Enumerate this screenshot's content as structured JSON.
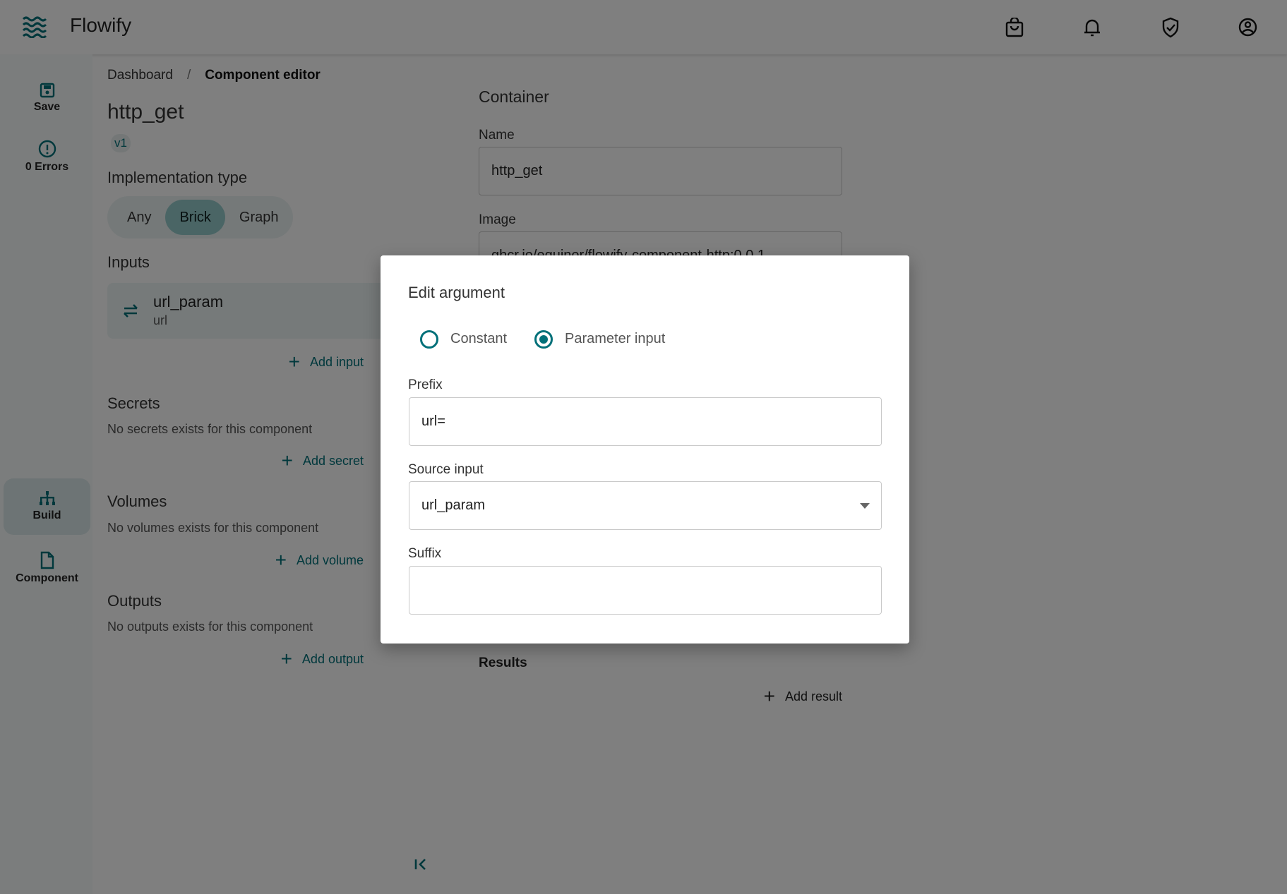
{
  "app": {
    "title": "Flowify",
    "accent": "#007079"
  },
  "header_icons": [
    "shopping-bag-icon",
    "bell-icon",
    "shield-check-icon",
    "account-circle-icon"
  ],
  "sidebar": {
    "items": [
      {
        "label": "Save",
        "icon": "save-icon"
      },
      {
        "label": "0 Errors",
        "icon": "error-icon"
      },
      {
        "label": "Build",
        "icon": "hierarchy-icon",
        "active": true
      },
      {
        "label": "Component",
        "icon": "file-icon"
      }
    ]
  },
  "breadcrumb": {
    "items": [
      "Dashboard",
      "Component editor"
    ],
    "separator": "/"
  },
  "component": {
    "title": "http_get",
    "version": "v1"
  },
  "implementation": {
    "heading": "Implementation type",
    "options": [
      "Any",
      "Brick",
      "Graph"
    ],
    "selected": "Brick"
  },
  "inputs": {
    "heading": "Inputs",
    "items": [
      {
        "name": "url_param",
        "type": "url"
      }
    ],
    "add_label": "Add input"
  },
  "secrets": {
    "heading": "Secrets",
    "empty": "No secrets exists for this component",
    "add_label": "Add secret"
  },
  "volumes": {
    "heading": "Volumes",
    "empty": "No volumes exists for this component",
    "add_label": "Add volume"
  },
  "outputs": {
    "heading": "Outputs",
    "empty": "No outputs exists for this component",
    "add_label": "Add output"
  },
  "container": {
    "heading": "Container",
    "name_label": "Name",
    "name_value": "http_get",
    "image_label": "Image",
    "image_value": "ghcr.io/equinor/flowify-component-http:0.0.1",
    "results_label": "Results",
    "add_result_label": "Add result"
  },
  "modal": {
    "title": "Edit argument",
    "radio_options": [
      "Constant",
      "Parameter input"
    ],
    "selected": "Parameter input",
    "prefix_label": "Prefix",
    "prefix_value": "url=",
    "source_label": "Source input",
    "source_value": "url_param",
    "suffix_label": "Suffix",
    "suffix_value": ""
  }
}
